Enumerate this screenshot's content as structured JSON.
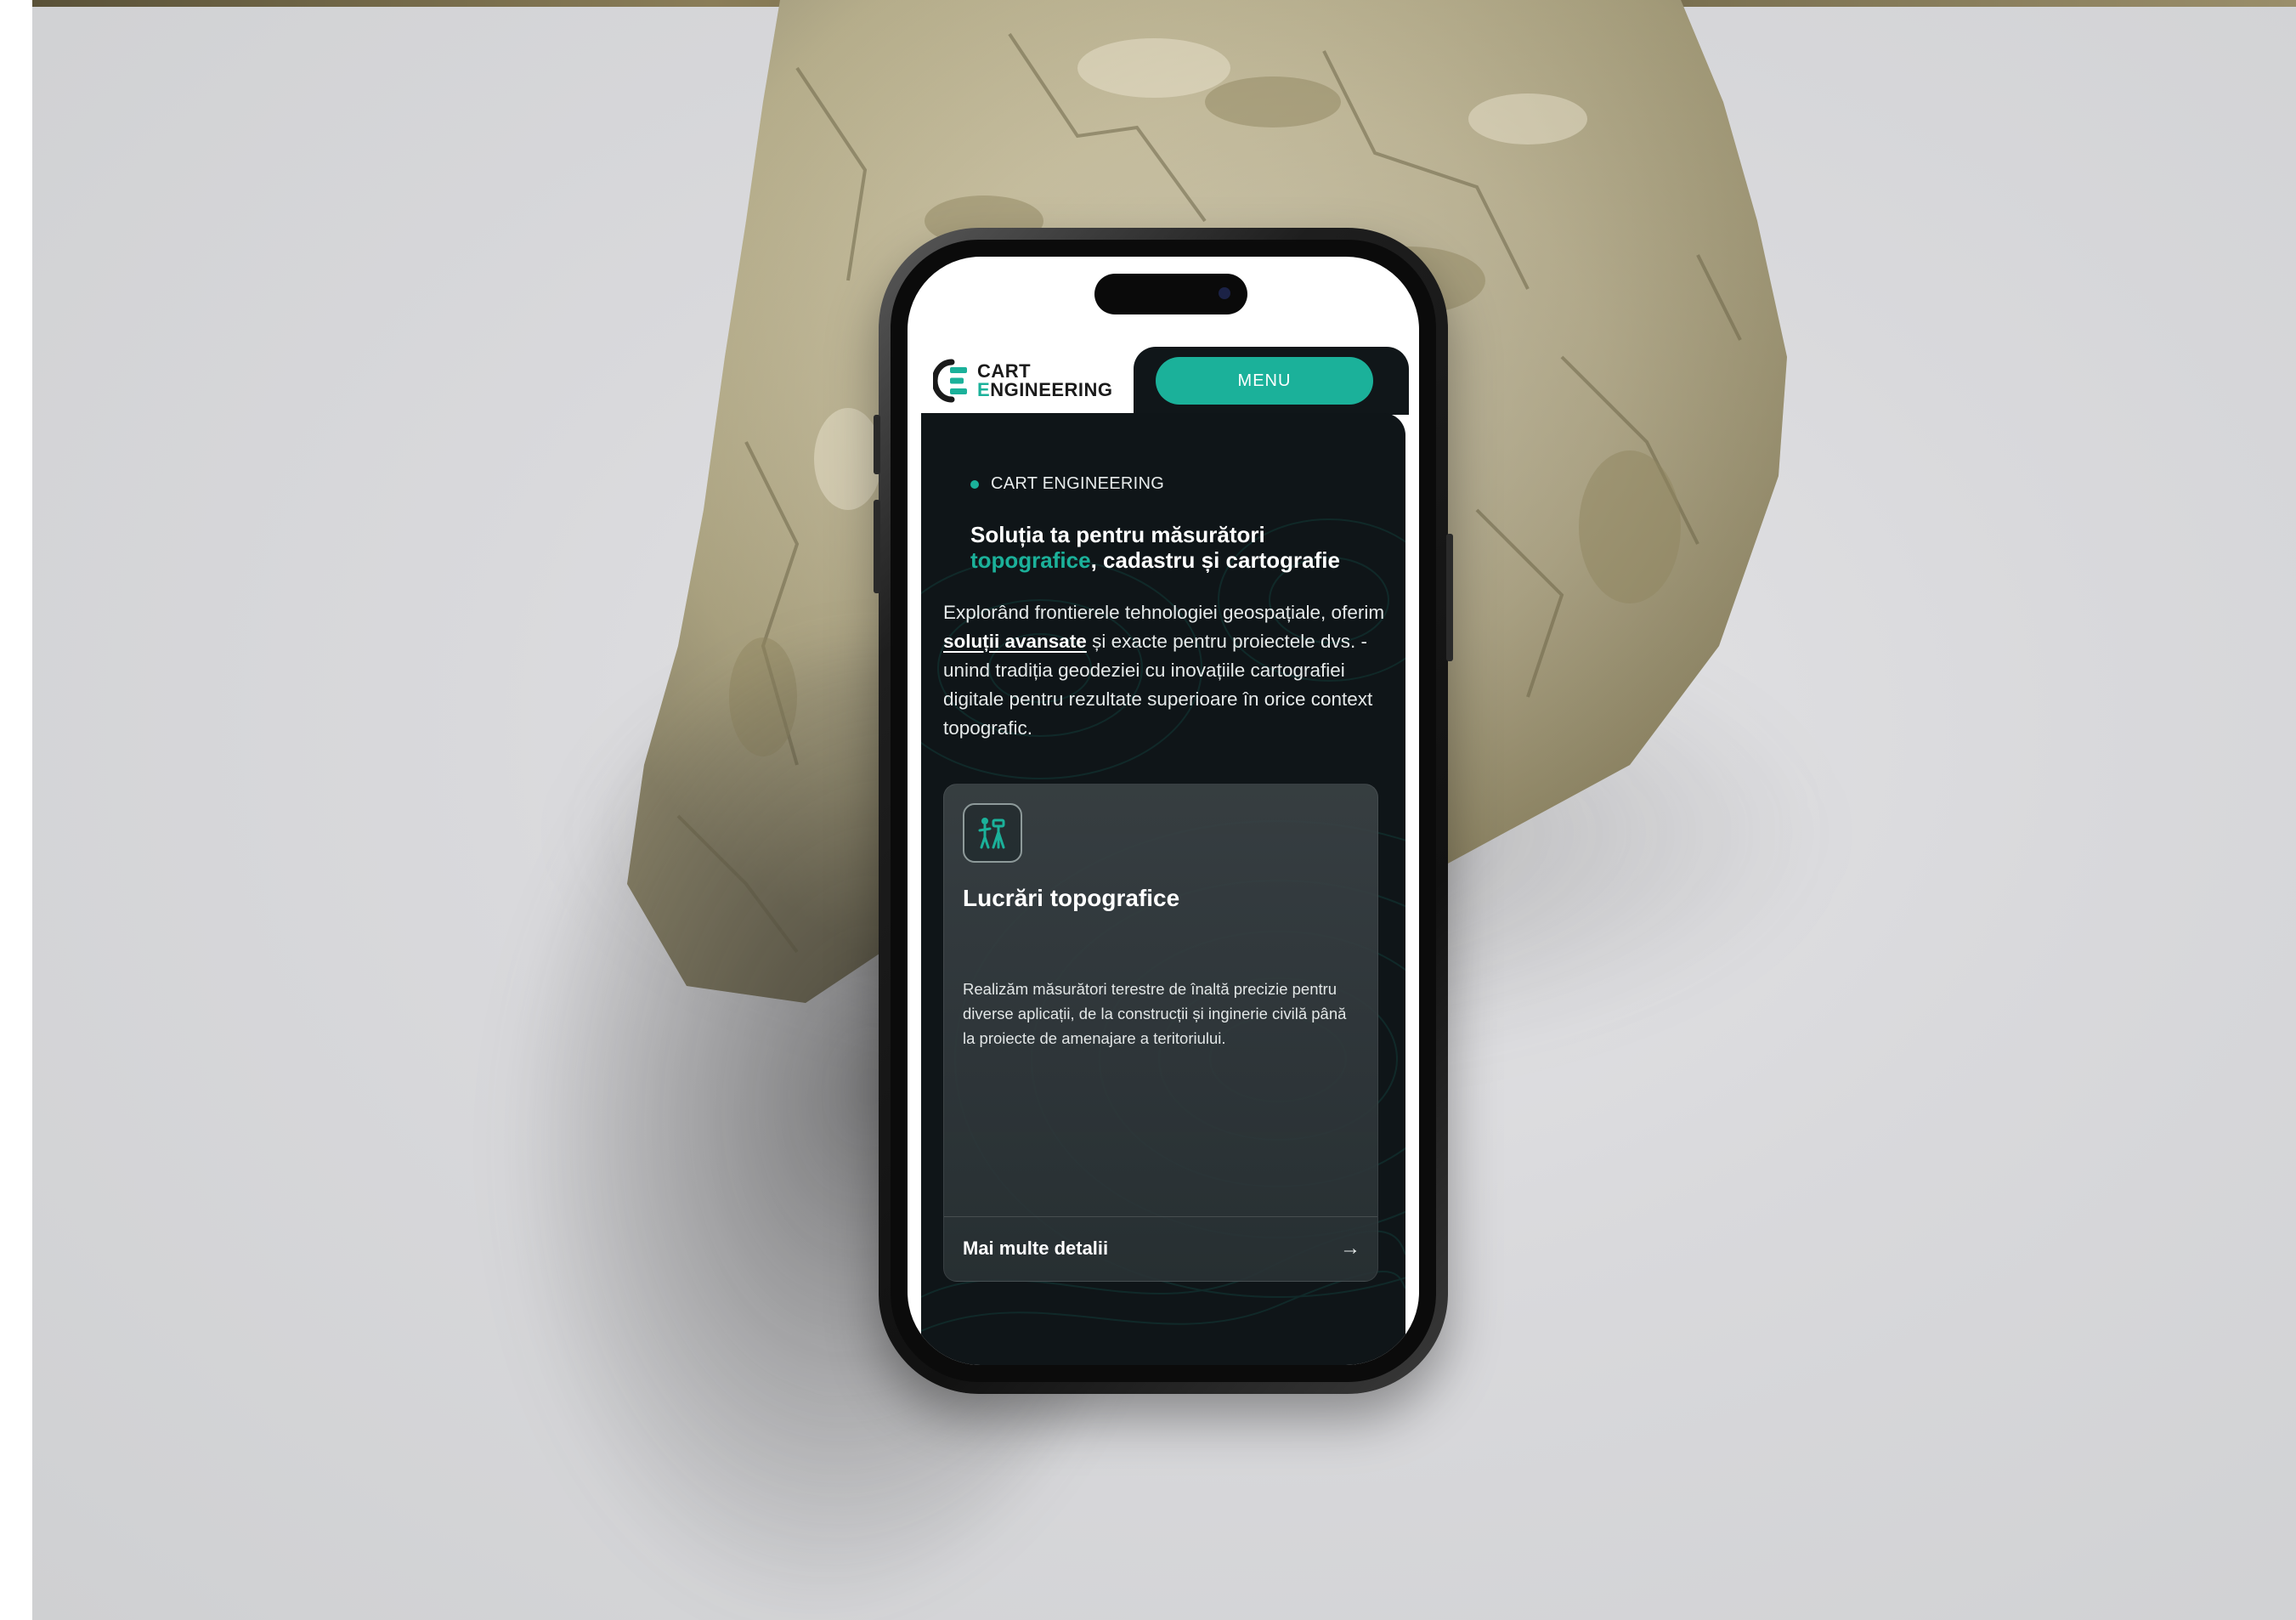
{
  "brand": {
    "line1": "CART",
    "line2_first_letter": "E",
    "line2_rest": "NGINEERING",
    "accent_color": "#1bb19a"
  },
  "header": {
    "menu_label": "MENU"
  },
  "hero": {
    "eyebrow": "CART ENGINEERING",
    "headline_part1": "Soluția ta pentru măsurători",
    "headline_highlight": "topografice",
    "headline_part2": ", cadastru și cartografie",
    "intro_part1": "Explorând frontierele tehnologiei geospațiale, oferim ",
    "intro_emphasis": "soluții avansate",
    "intro_part2": " și exacte pentru proiectele dvs. - unind tradiția geodeziei cu inovațiile cartografiei digitale pentru rezultate superioare în orice context topografic."
  },
  "service_card": {
    "icon": "surveyor-tripod-icon",
    "title": "Lucrări topografice",
    "description": "Realizăm măsurători terestre de înaltă precizie pentru diverse aplicații, de la construcții și inginerie civilă până la proiecte de amenajare a teritoriului.",
    "link_label": "Mai multe detalii",
    "link_icon": "arrow-right-icon"
  },
  "colors": {
    "dark_panel": "#0f1518",
    "card": "#3a4245",
    "backdrop": "#d9d9dc"
  }
}
